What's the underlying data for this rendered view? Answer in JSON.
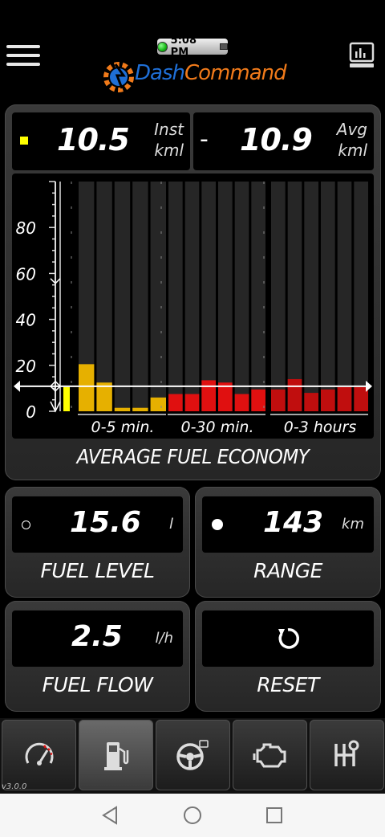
{
  "header": {
    "clock": "5:08 PM",
    "logo_dash": "Dash",
    "logo_command": "Command"
  },
  "fuel_economy": {
    "inst_value": "10.5",
    "inst_unit_top": "Inst",
    "inst_unit_bottom": "kml",
    "separator": "-",
    "avg_value": "10.9",
    "avg_unit_top": "Avg",
    "avg_unit_bottom": "kml",
    "title": "AVERAGE FUEL ECONOMY"
  },
  "chart_data": {
    "type": "bar",
    "ylim": [
      0,
      100
    ],
    "yticks": [
      0,
      20,
      40,
      60,
      80
    ],
    "ytick_labels": [
      "0",
      "20",
      "40",
      "60",
      "80"
    ],
    "reference_line": 10.9,
    "current_value": 10.5,
    "groups": [
      {
        "label": "0-5 min.",
        "values": [
          20.5,
          12.5,
          1.5,
          1.5,
          6
        ],
        "color": "#e6b000"
      },
      {
        "label": "0-30 min.",
        "values": [
          7.5,
          7.5,
          13.5,
          12.5,
          7.5,
          9.5
        ],
        "color": "#e01010"
      },
      {
        "label": "0-3 hours",
        "values": [
          9.5,
          14,
          8,
          9.5,
          10.5,
          10.5
        ],
        "color": "#c00e0e"
      }
    ]
  },
  "fuel_level": {
    "value": "15.6",
    "unit": "l",
    "label": "FUEL LEVEL"
  },
  "range": {
    "value": "143",
    "unit": "km",
    "label": "RANGE"
  },
  "fuel_flow": {
    "value": "2.5",
    "unit": "l/h",
    "label": "FUEL FLOW"
  },
  "reset": {
    "label": "RESET"
  },
  "nav": {
    "tabs": [
      {
        "name": "gauge-icon",
        "active": false
      },
      {
        "name": "fuel-pump-icon",
        "active": true
      },
      {
        "name": "steering-wheel-icon",
        "active": false
      },
      {
        "name": "check-engine-icon",
        "active": false
      },
      {
        "name": "gear-shifter-icon",
        "active": false
      }
    ],
    "version": "v3.0.0"
  },
  "colors": {
    "accent_yellow": "#ffff00",
    "bar_yellow": "#e6b000",
    "bar_red": "#e01010",
    "logo_blue": "#1f6fd6",
    "logo_orange": "#f07a1a"
  }
}
